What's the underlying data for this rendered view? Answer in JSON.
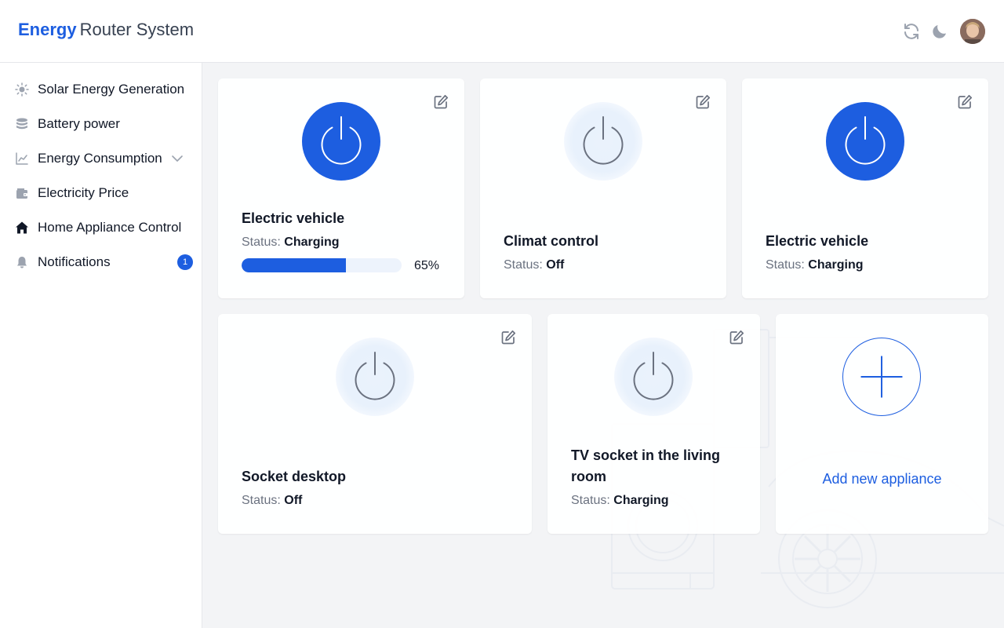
{
  "app": {
    "brand_bold": "Energy",
    "brand_rest": "Router System"
  },
  "header": {
    "icons": [
      "refresh-icon",
      "moon-icon"
    ],
    "avatar": "user-avatar"
  },
  "sidebar": {
    "items": [
      {
        "label": "Solar Energy Generation",
        "icon": "sun-icon"
      },
      {
        "label": "Battery power",
        "icon": "database-icon"
      },
      {
        "label": "Energy Consumption",
        "icon": "chart-line-icon",
        "expandable": true
      },
      {
        "label": "Electricity Price",
        "icon": "wallet-icon"
      },
      {
        "label": "Home Appliance Control",
        "icon": "home-icon",
        "active": true
      },
      {
        "label": "Notifications",
        "icon": "bell-icon",
        "badge": "1"
      }
    ]
  },
  "appliances": [
    {
      "name": "Electric vehicle",
      "status_label": "Status:",
      "status": "Charging",
      "power": "on",
      "progress": 0.65,
      "progress_text": "65%"
    },
    {
      "name": "Climat control",
      "status_label": "Status:",
      "status": "Off",
      "power": "off"
    },
    {
      "name": "Electric vehicle",
      "status_label": "Status:",
      "status": "Charging",
      "power": "on"
    },
    {
      "name": "Socket desktop",
      "status_label": "Status:",
      "status": "Off",
      "power": "off"
    },
    {
      "name": "TV socket in the living room",
      "status_label": "Status:",
      "status": "Charging",
      "power": "off"
    }
  ],
  "add_card": {
    "label": "Add new appliance"
  },
  "colors": {
    "accent": "#1d5ee0",
    "text": "#111827",
    "muted": "#6b7280",
    "background": "#f3f4f6"
  }
}
